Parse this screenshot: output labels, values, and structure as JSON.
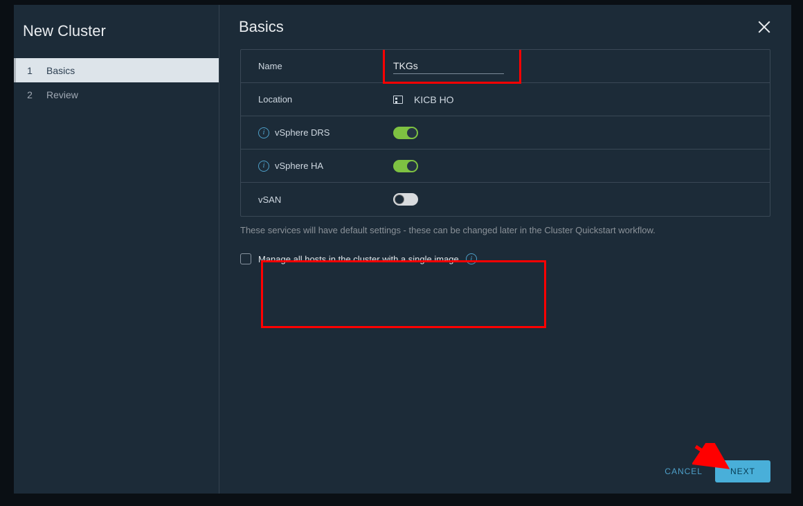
{
  "sidebar": {
    "title": "New Cluster",
    "steps": [
      {
        "num": "1",
        "label": "Basics"
      },
      {
        "num": "2",
        "label": "Review"
      }
    ]
  },
  "header": {
    "title": "Basics"
  },
  "rows": {
    "name": {
      "label": "Name",
      "value": "TKGs"
    },
    "location": {
      "label": "Location",
      "value": "KICB HO"
    },
    "drs": {
      "label": "vSphere DRS"
    },
    "ha": {
      "label": "vSphere HA"
    },
    "vsan": {
      "label": "vSAN"
    }
  },
  "hint": "These services will have default settings - these can be changed later in the Cluster Quickstart workflow.",
  "checkbox": "Manage all hosts in the cluster with a single image",
  "footer": {
    "cancel": "CANCEL",
    "next": "NEXT"
  }
}
